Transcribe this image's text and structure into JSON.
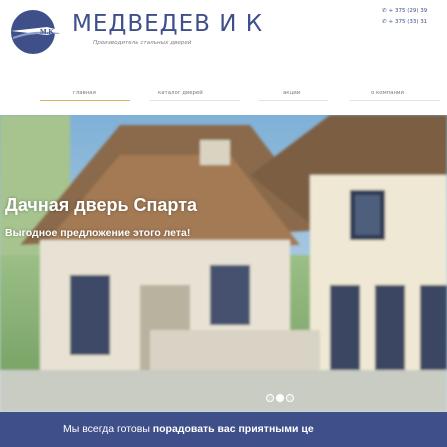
{
  "header": {
    "brand_name": "МЕДВЕДЕВ И К",
    "tagline": "Производитель стальных дверей",
    "logo_text": "M.K",
    "phones": [
      "+ 375 (29) 39",
      "+ 375 (33) 31"
    ]
  },
  "nav": {
    "items": [
      "главная",
      "каталог дверей",
      "акции",
      "о компании"
    ],
    "active_index": 0
  },
  "hero": {
    "title": "Дачная дверь Спарта",
    "subtitle": "Выгодное предложение этого лета!",
    "slides_total": 3,
    "active_slide": 1
  },
  "bottom": {
    "text_normal": "Мы всегда готовы ",
    "text_bold": "порадовать вас приятными це"
  },
  "colors": {
    "brand": "#3e4f8a",
    "accent": "#d8b25e"
  }
}
